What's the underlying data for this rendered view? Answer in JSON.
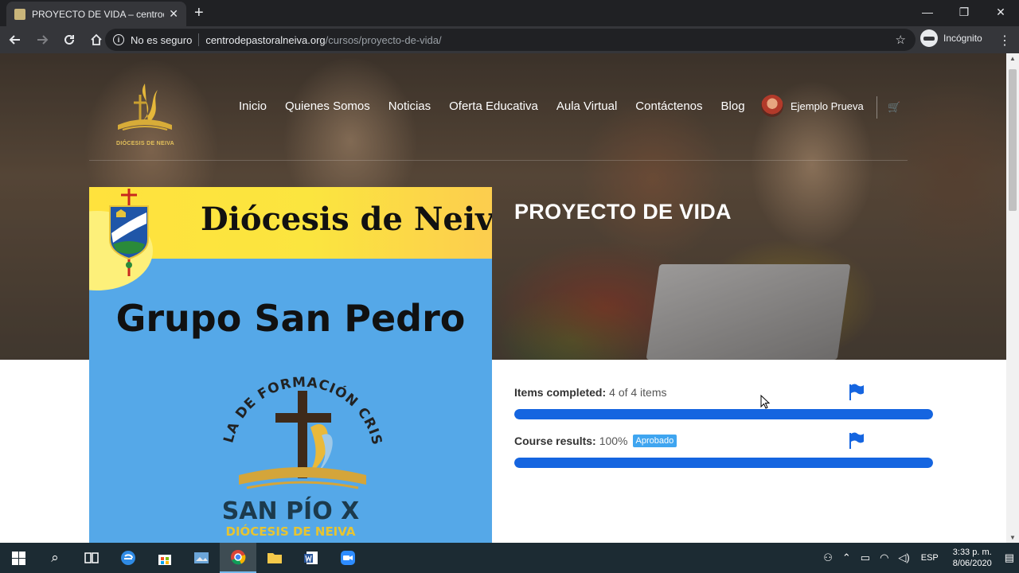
{
  "browser": {
    "tab_title": "PROYECTO DE VIDA – centrodepastoralneiva.org",
    "new_tab_glyph": "+",
    "tab_close_glyph": "✕",
    "security_text": "No es seguro",
    "url_host": "centrodepastoralneiva.org",
    "url_path": "/cursos/proyecto-de-vida/",
    "incognito_label": "Incógnito",
    "window_controls": [
      "—",
      "❐",
      "✕"
    ]
  },
  "site": {
    "logo_caption": "DIÓCESIS DE NEIVA",
    "nav": [
      "Inicio",
      "Quienes Somos",
      "Noticias",
      "Oferta Educativa",
      "Aula Virtual",
      "Contáctenos",
      "Blog"
    ],
    "user_name": "Ejemplo Prueva"
  },
  "course": {
    "title": "PROYECTO DE VIDA",
    "image": {
      "diocese_title": "Diócesis de Neiva",
      "group_title": "Grupo San Pedro",
      "emblem_text": "ESCUELA DE FORMACIÓN CRISTIANA",
      "school_name": "SAN PÍO X",
      "school_sub": "DIÓCESIS DE NEIVA"
    },
    "items_completed": {
      "label": "Items completed:",
      "value": "4 of 4 items",
      "progress": 1.0
    },
    "course_results": {
      "label": "Course results:",
      "value": "100%",
      "badge": "Aprobado",
      "progress": 1.0
    }
  },
  "taskbar": {
    "language": "ESP",
    "time": "3:33 p. m.",
    "date": "8/06/2020"
  },
  "colors": {
    "progress_fill": "#1565e0",
    "badge": "#3fa5f0",
    "taskbar": "#1c2b33"
  }
}
